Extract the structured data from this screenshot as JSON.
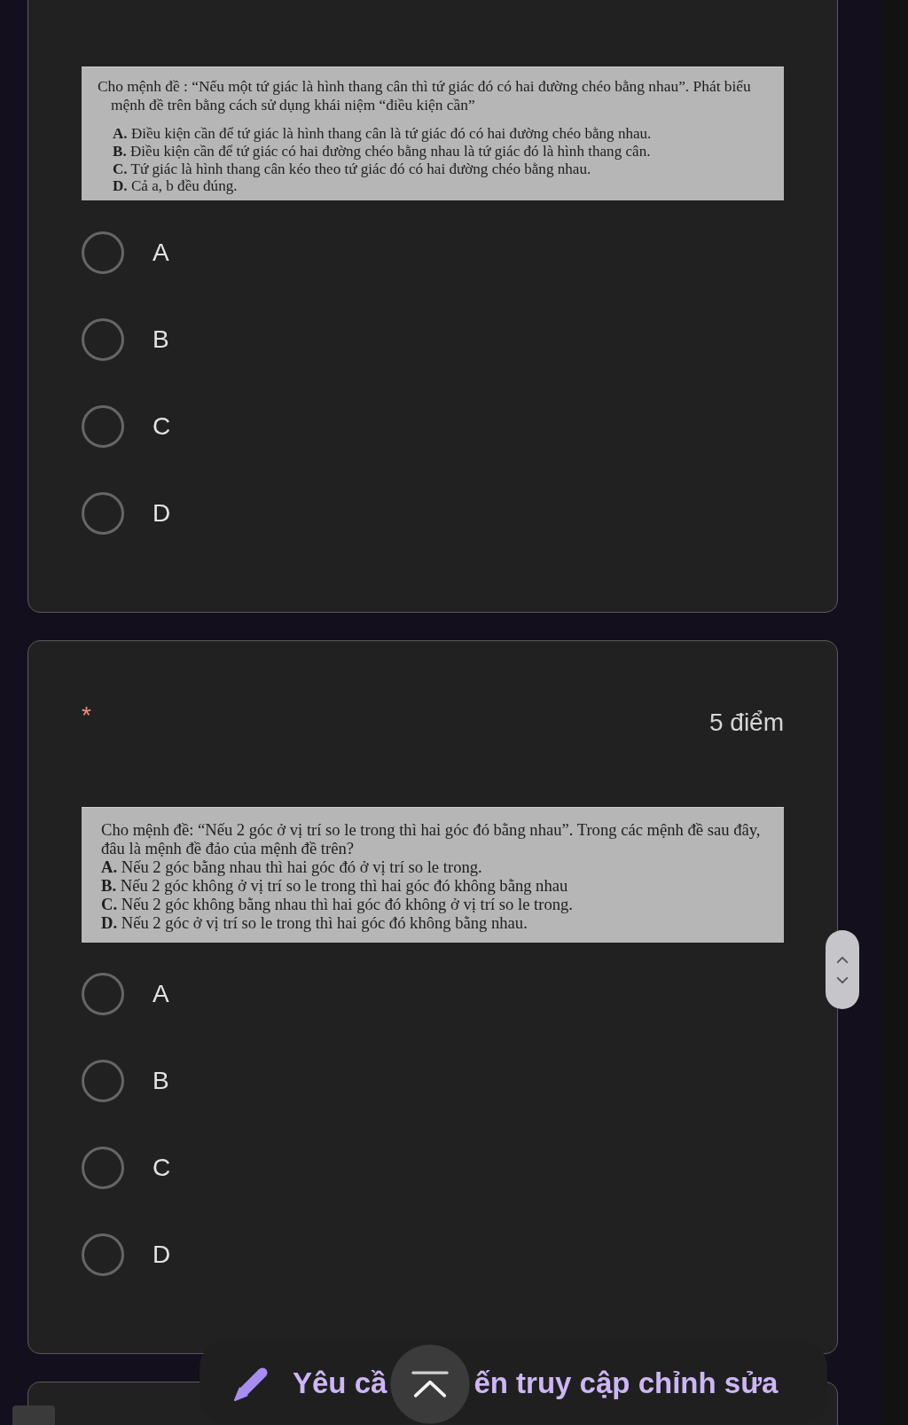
{
  "questions": [
    {
      "document": {
        "kind": "indented",
        "prompt": "Cho mệnh đề : “Nếu một tứ giác là hình thang cân thì tứ giác đó có hai đường chéo bằng nhau”. Phát biểu mệnh đề trên bằng cách sử dụng khái niệm “điều kiện cần”",
        "options": [
          "**A.** Điều kiện cần để tứ giác là hình thang cân là tứ giác đó có hai đường chéo bằng nhau.",
          "**B.** Điều kiện cần để tứ giác có hai đường chéo bằng nhau là tứ giác đó là hình thang cân.",
          "**C.** Tứ giác là hình thang cân kéo theo tứ giác đó có hai đường chéo bằng nhau.",
          "**D.** Cả a, b đều đúng."
        ]
      },
      "choices": [
        {
          "label": "A",
          "selected": false
        },
        {
          "label": "B",
          "selected": false
        },
        {
          "label": "C",
          "selected": false
        },
        {
          "label": "D",
          "selected": false
        }
      ]
    },
    {
      "required_mark": "*",
      "points": "5 điểm",
      "document": {
        "kind": "compact",
        "prompt": "Cho mệnh đề: “Nếu 2 góc ở vị trí so le trong thì hai góc đó bằng nhau”. Trong các mệnh đề sau đây, đâu là mệnh đề đảo của mệnh đề trên?",
        "options": [
          "**A.** Nếu 2 góc bằng nhau thì hai góc đó ở vị trí so le trong.",
          "**B.** Nếu 2 góc không ở vị trí so le trong thì hai góc đó không bằng nhau",
          "**C.** Nếu 2 góc không bằng nhau thì hai góc đó không ở vị trí so le trong.",
          "**D.** Nếu 2 góc ở vị trí so le trong thì hai góc đó không bằng nhau."
        ]
      },
      "choices": [
        {
          "label": "A",
          "selected": false
        },
        {
          "label": "B",
          "selected": false
        },
        {
          "label": "C",
          "selected": false
        },
        {
          "label": "D",
          "selected": false
        }
      ]
    }
  ],
  "edit_access_bar": {
    "text_before": "Yêu cầ",
    "text_after": "ến truy cập chỉnh sửa"
  }
}
